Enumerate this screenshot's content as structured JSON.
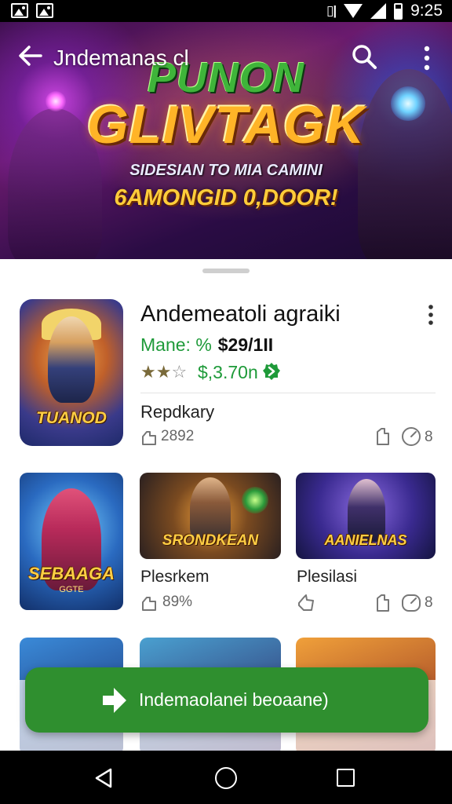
{
  "status_bar": {
    "time": "9:25",
    "icons": [
      "image-icon",
      "image-icon",
      "vibrate-icon",
      "wifi-icon",
      "signal-icon",
      "battery-icon"
    ]
  },
  "app_bar": {
    "title": "Jndemanas cl",
    "icons": [
      "back-arrow-icon",
      "search-icon",
      "more-vertical-icon"
    ]
  },
  "hero": {
    "title_top": "PUNON",
    "title_main": "GLIVTAGK",
    "subtitle": "SIDESIAN TO MIA CAMINI",
    "promo": "6AMONGID 0,DOOR!"
  },
  "featured": {
    "cover_label": "TUANOD",
    "title": "Andemeatoli agraiki",
    "discount": "Mane: %",
    "price": "$29/1II",
    "rating": 2,
    "rating_max": 5,
    "sales": "$,3.70n",
    "category": "Repdkary",
    "stat": "2892",
    "downloads": "8"
  },
  "grid": [
    {
      "cover_label": "SEBAAGA",
      "cover_sub": "GGTE",
      "title": "",
      "stat": "",
      "downloads": ""
    },
    {
      "cover_label": "SRONDKEAN",
      "title": "Plesrkem",
      "stat": "89%",
      "downloads": ""
    },
    {
      "cover_label": "AANIELNAS",
      "title": "Plesilasi",
      "stat": "",
      "downloads": "8"
    }
  ],
  "cta": {
    "label": "Indemaolanei beoaane)"
  },
  "colors": {
    "accent_green": "#2f8f2f",
    "price_green": "#1e9a39",
    "status_bar": "#000000"
  }
}
